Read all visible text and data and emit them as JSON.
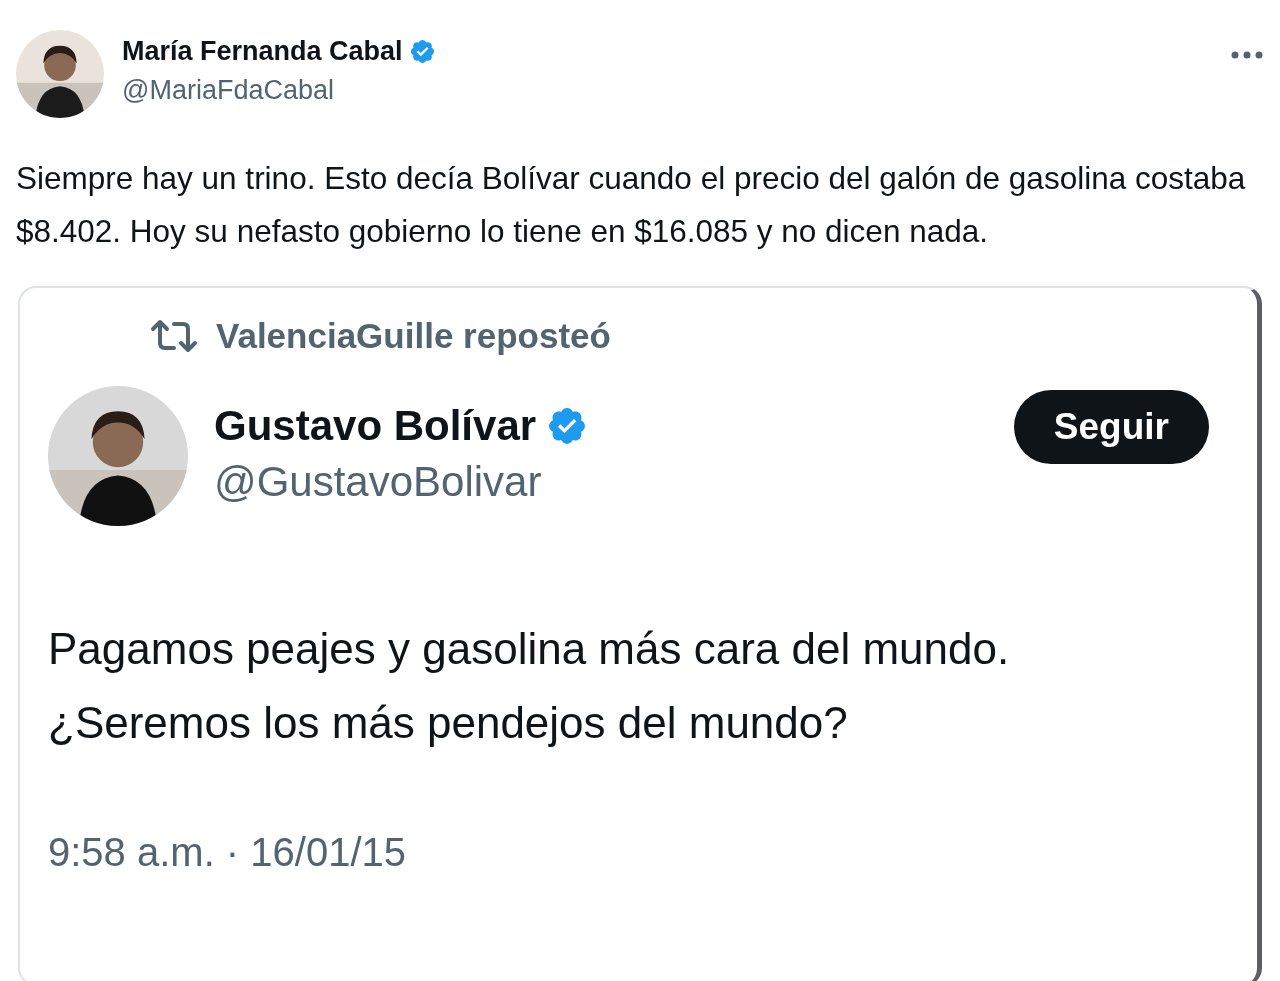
{
  "post": {
    "author": {
      "name": "María Fernanda Cabal",
      "handle": "@MariaFdaCabal",
      "verified": true
    },
    "text": "Siempre hay un trino. Esto decía Bolívar cuando el precio del galón de gasolina costaba $8.402. Hoy su nefasto gobierno lo tiene en $16.085 y no dicen nada.",
    "quote": {
      "repost_label": "ValenciaGuille reposteó",
      "author": {
        "name": "Gustavo Bolívar",
        "handle": "@GustavoBolivar",
        "verified": true
      },
      "follow_button": "Seguir",
      "text_lines": [
        "Pagamos peajes y gasolina más cara del mundo.",
        "¿Seremos los más pendejos del mundo?"
      ],
      "timestamp": "9:58 a.m. · 16/01/15"
    }
  }
}
